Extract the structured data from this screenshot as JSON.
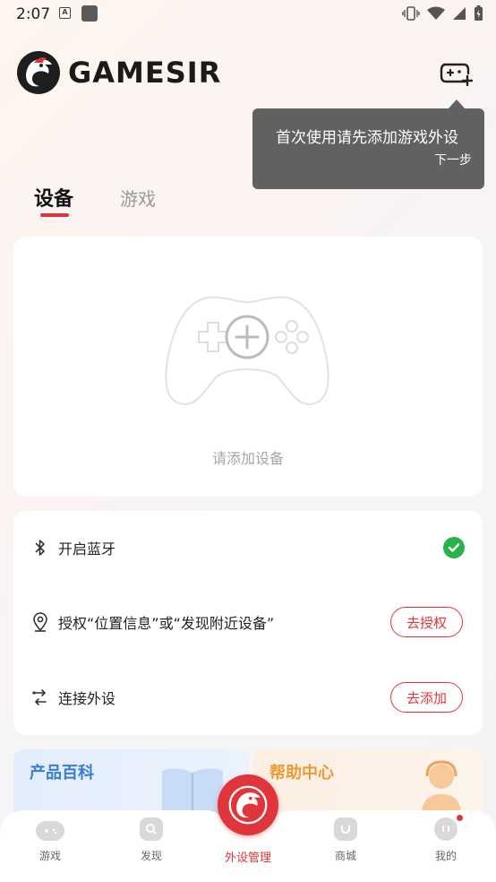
{
  "status_bar": {
    "time": "2:07",
    "notif_icon_letter": "A"
  },
  "header": {
    "brand": "GAMESIR"
  },
  "tooltip": {
    "message": "首次使用请先添加游戏外设",
    "next_label": "下一步"
  },
  "tabs": [
    {
      "label": "设备",
      "active": true
    },
    {
      "label": "游戏",
      "active": false
    }
  ],
  "empty_state": {
    "text": "请添加设备"
  },
  "permissions": {
    "bluetooth": {
      "label": "开启蓝牙",
      "status": "enabled"
    },
    "location": {
      "label": "授权“位置信息”或“发现附近设备”",
      "button": "去授权"
    },
    "connect": {
      "label": "连接外设",
      "button": "去添加"
    }
  },
  "promos": [
    {
      "title": "产品百科"
    },
    {
      "title": "帮助中心"
    }
  ],
  "bottom_nav": [
    {
      "label": "游戏"
    },
    {
      "label": "发现"
    },
    {
      "label": "外设管理",
      "active": true
    },
    {
      "label": "商城"
    },
    {
      "label": "我的",
      "has_badge": true
    }
  ],
  "colors": {
    "accent": "#e0353b",
    "success": "#2ab24a",
    "tooltip_bg": "#616161"
  }
}
